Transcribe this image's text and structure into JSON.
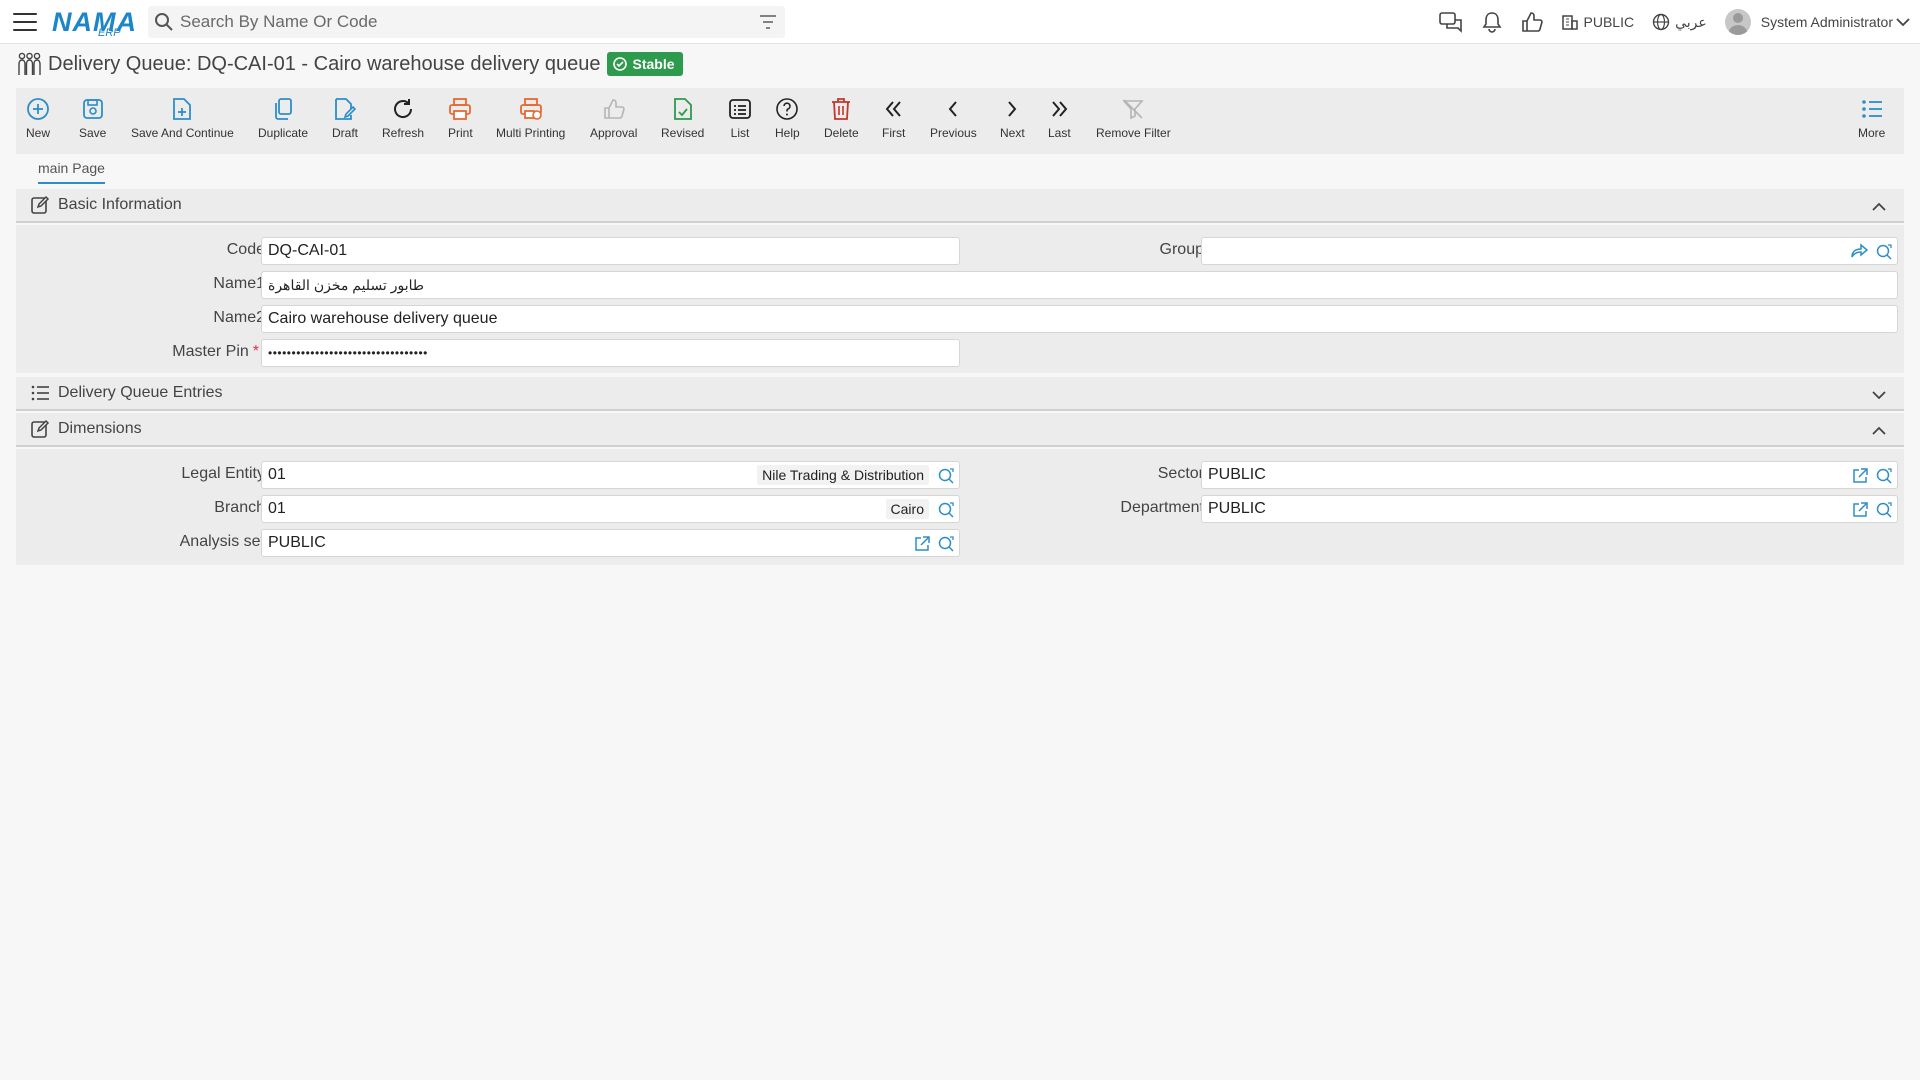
{
  "topbar": {
    "logo_main": "NAMA",
    "logo_sub": "ERP",
    "search_placeholder": "Search By Name Or Code",
    "entity": "PUBLIC",
    "language": "عربي",
    "user": "System Administrator"
  },
  "page": {
    "title": "Delivery Queue: DQ-CAI-01 - Cairo warehouse delivery queue",
    "status": "Stable"
  },
  "toolbar": {
    "new": "New",
    "save": "Save",
    "save_continue": "Save And Continue",
    "duplicate": "Duplicate",
    "draft": "Draft",
    "refresh": "Refresh",
    "print": "Print",
    "multi_printing": "Multi Printing",
    "approval": "Approval",
    "revised": "Revised",
    "list": "List",
    "help": "Help",
    "delete": "Delete",
    "first": "First",
    "previous": "Previous",
    "next": "Next",
    "last": "Last",
    "remove_filter": "Remove Filter",
    "more": "More"
  },
  "tabs": {
    "main": "main Page"
  },
  "basic": {
    "title": "Basic Information",
    "code_label": "Code",
    "code": "DQ-CAI-01",
    "group_label": "Group",
    "group": "",
    "name1_label": "Name1",
    "name1": "طابور تسليم مخزن القاهرة",
    "name2_label": "Name2",
    "name2": "Cairo warehouse delivery queue",
    "masterpin_label": "Master Pin",
    "masterpin_required": "*",
    "masterpin": "••••••••••••••••••••••••••••••••••"
  },
  "entries": {
    "title": "Delivery Queue Entries"
  },
  "dimensions": {
    "title": "Dimensions",
    "legal_entity_label": "Legal Entity",
    "legal_entity": "01",
    "legal_entity_name": "Nile Trading & Distribution",
    "sector_label": "Sector",
    "sector": "PUBLIC",
    "branch_label": "Branch",
    "branch": "01",
    "branch_name": "Cairo",
    "department_label": "Department",
    "department": "PUBLIC",
    "analysis_label": "Analysis set",
    "analysis": "PUBLIC"
  },
  "colors": {
    "accent": "#2c8ec9",
    "print": "#e8692f",
    "delete": "#c0392b",
    "revised": "#2e9a4d",
    "badge": "#2e9a4d"
  }
}
